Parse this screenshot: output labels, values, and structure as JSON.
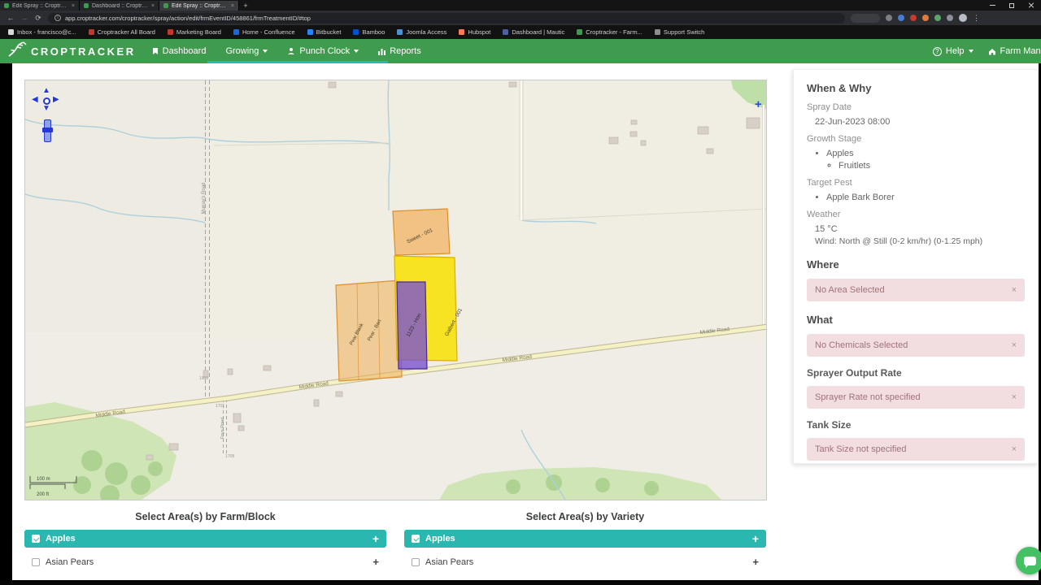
{
  "browser": {
    "tabs": [
      {
        "title": "Edit Spray :: Croptracker"
      },
      {
        "title": "Dashboard :: Croptracker"
      },
      {
        "title": "Edit Spray :: Croptracker"
      }
    ],
    "url": "app.croptracker.com/croptracker/spray/action/edit/frmEventID/458861/frmTreatmentID/#top",
    "bookmarks": [
      {
        "label": "Inbox - francisco@c..."
      },
      {
        "label": "Croptracker All Board"
      },
      {
        "label": "Marketing Board"
      },
      {
        "label": "Home - Confluence"
      },
      {
        "label": "Bitbucket"
      },
      {
        "label": "Bamboo"
      },
      {
        "label": "Joomla Access"
      },
      {
        "label": "Hubspot"
      },
      {
        "label": "Dashboard | Mautic"
      },
      {
        "label": "Croptracker - Farm..."
      },
      {
        "label": "Support Switch"
      }
    ]
  },
  "icons": {
    "back": "←",
    "forward": "→",
    "reload": "⟳",
    "menu": "⋮",
    "close": "×",
    "plus": "+",
    "help": "?",
    "info": "i",
    "pan_up": "▲",
    "pan_down": "▼",
    "pan_left": "◀",
    "pan_right": "▶"
  },
  "header": {
    "brand": "CROPTRACKER",
    "nav_dashboard": "Dashboard",
    "nav_growing": "Growing",
    "nav_punch_clock": "Punch Clock",
    "nav_reports": "Reports",
    "help": "Help",
    "farm_manage": "Farm Manage"
  },
  "map": {
    "road_middle": "Middle Road",
    "road_murrays": "Murray's Road",
    "road_foys": "Foys Road",
    "fields": {
      "sweet": "Sweet - 001",
      "yellow": "Galbert - 001",
      "purple": "1123 - Hon",
      "pear_a": "Pear - Bart",
      "pear_b": "Pear Blank"
    },
    "markers": [
      "1901",
      "1701",
      "1708"
    ],
    "scale_m": "100 m",
    "scale_ft": "200 ft",
    "add_marker": "+"
  },
  "panel": {
    "when_why_title": "When & Why",
    "spray_date_label": "Spray Date",
    "spray_date": "22-Jun-2023 08:00",
    "growth_stage_label": "Growth Stage",
    "growth_stage_crop": "Apples",
    "growth_stage_stage": "Fruitlets",
    "target_pest_label": "Target Pest",
    "target_pest": "Apple Bark Borer",
    "weather_label": "Weather",
    "temperature": "15 °C",
    "wind": "Wind: North @ Still (0-2 km/hr) (0-1.25 mph)",
    "where_title": "Where",
    "where_alert": "No Area Selected",
    "what_title": "What",
    "what_alert": "No Chemicals Selected",
    "sprayer_title": "Sprayer Output Rate",
    "sprayer_alert": "Sprayer Rate not specified",
    "tank_title": "Tank Size",
    "tank_alert": "Tank Size not specified"
  },
  "selectors": {
    "farm_block_title": "Select Area(s) by Farm/Block",
    "variety_title": "Select Area(s) by Variety",
    "group_apples": "Apples",
    "group_asian_pears": "Asian Pears"
  }
}
